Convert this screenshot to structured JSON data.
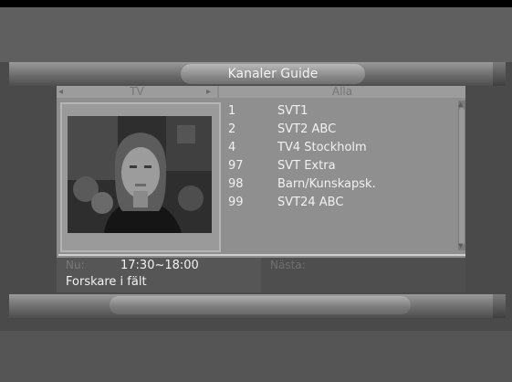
{
  "header": {
    "title": "Kanaler Guide"
  },
  "tabs": {
    "tv": "TV",
    "alla": "Alla",
    "arrow_left": "◂",
    "arrow_right": "▸"
  },
  "channels": [
    {
      "number": "1",
      "name": "SVT1"
    },
    {
      "number": "2",
      "name": "SVT2 ABC"
    },
    {
      "number": "4",
      "name": "TV4 Stockholm"
    },
    {
      "number": "97",
      "name": "SVT Extra"
    },
    {
      "number": "98",
      "name": "Barn/Kunskapsk."
    },
    {
      "number": "99",
      "name": "SVT24 ABC"
    }
  ],
  "info": {
    "now_label": "Nu:",
    "now_time": "17:30~18:00",
    "now_program": "Forskare i fält",
    "next_label": "Nästa:"
  },
  "icons": {
    "scroll_up": "scroll-up-icon",
    "scroll_down": "scroll-down-icon"
  }
}
